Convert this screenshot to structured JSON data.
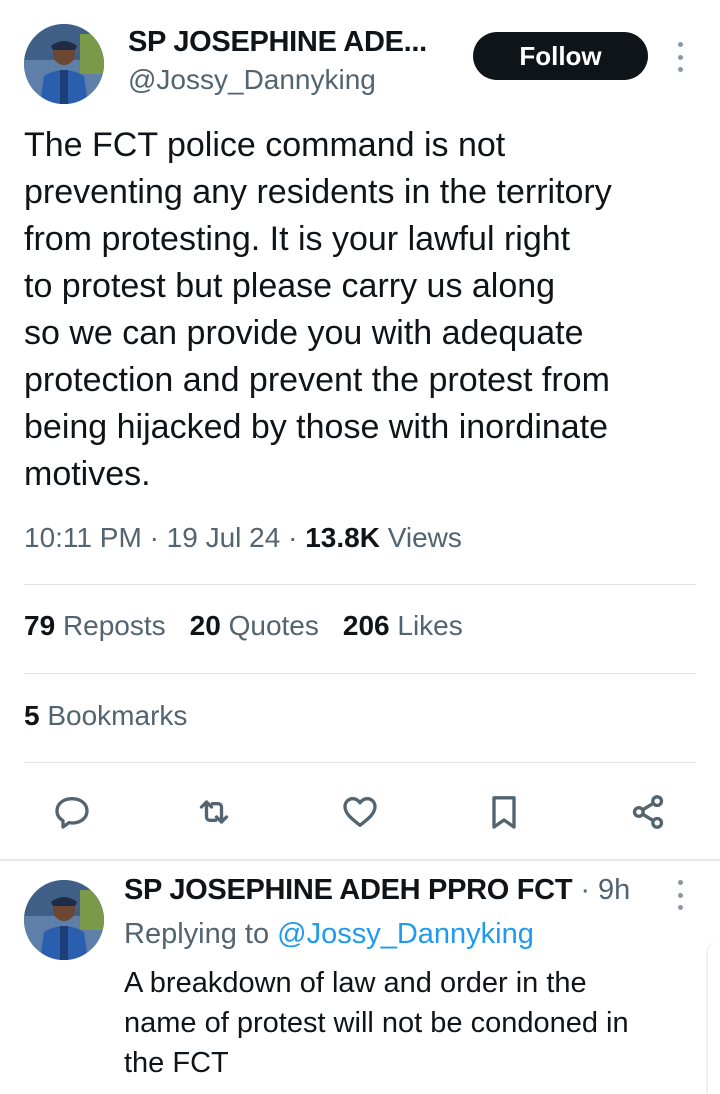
{
  "tweet": {
    "author_name": "SP JOSEPHINE ADE...",
    "author_handle": "@Jossy_Dannyking",
    "follow_label": "Follow",
    "text_lines": [
      "The FCT police command is not",
      "preventing any residents in the territory",
      "from protesting. It is your lawful right",
      "to protest but please carry us along",
      "so we can provide you with adequate",
      "protection and prevent the protest from",
      "being hijacked by those with inordinate",
      "motives."
    ],
    "time": "10:11 PM",
    "date": "19 Jul 24",
    "views_count": "13.8K",
    "views_label": "Views",
    "reposts_count": "79",
    "reposts_label": "Reposts",
    "quotes_count": "20",
    "quotes_label": "Quotes",
    "likes_count": "206",
    "likes_label": "Likes",
    "bookmarks_count": "5",
    "bookmarks_label": "Bookmarks"
  },
  "actions": {
    "icons": [
      "reply-icon",
      "repost-icon",
      "like-icon",
      "bookmark-icon",
      "share-icon"
    ]
  },
  "reply": {
    "author_name": "SP JOSEPHINE ADEH PPRO FCT",
    "age": "9h",
    "replying_prefix": "Replying to",
    "replying_to": "@Jossy_Dannyking",
    "text_lines": [
      "A breakdown of law and order in the",
      "name of protest will not be condoned in",
      "the FCT"
    ]
  },
  "colors": {
    "text": "#0f1419",
    "muted": "#536471",
    "link": "#1d9bf0",
    "follow_bg": "#0f1419"
  }
}
